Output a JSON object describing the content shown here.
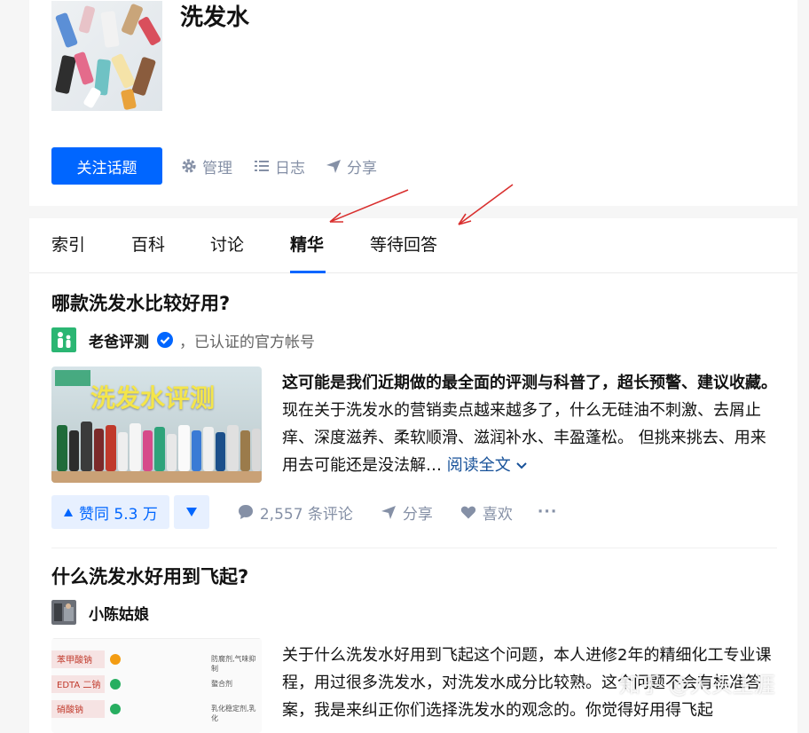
{
  "topic": {
    "title": "洗发水",
    "follow_label": "关注话题",
    "actions": [
      {
        "icon": "gear-icon",
        "label": "管理"
      },
      {
        "icon": "list-icon",
        "label": "日志"
      },
      {
        "icon": "share-icon",
        "label": "分享"
      }
    ]
  },
  "tabs": [
    "索引",
    "百科",
    "讨论",
    "精华",
    "等待回答"
  ],
  "active_tab": "精华",
  "answers": [
    {
      "question": "哪款洗发水比较好用?",
      "author": "老爸评测",
      "author_desc": "，已认证的官方帐号",
      "thumb_text": "洗发水评测",
      "excerpt_bold": "这可能是我们近期做的最全面的评测与科普了，超长预警、建议收藏。",
      "excerpt": " 现在关于洗发水的营销卖点越来越多了，什么无硅油不刺激、去屑止痒、深度滋养、柔软顺滑、滋润补水、丰盈蓬松。 但挑来挑去、用来用去可能还是没法解…",
      "read_more": "阅读全文",
      "vote_label": "赞同 5.3 万",
      "comments": "2,557 条评论",
      "share": "分享",
      "like": "喜欢",
      "more": "···"
    },
    {
      "question": "什么洗发水好用到飞起?",
      "author": "小陈姑娘",
      "excerpt": "关于什么洗发水好用到飞起这个问题，本人进修2年的精细化工专业课程，用过很多洗发水，对洗发水成分比较熟。这个问题不会有标准答案，我是来纠正你们选择洗发水的观念的。你觉得好用得飞起",
      "table_rows": [
        "苯甲酸钠",
        "EDTA 二钠",
        "硝酸钠"
      ],
      "table_right": [
        "防腐剂,气味抑制",
        "螯合剂",
        "乳化稳定剂,乳化"
      ]
    }
  ],
  "watermark": "知乎 @大头生涯",
  "colors": {
    "accent": "#0066ff",
    "muted": "#8590a6",
    "link": "#175199",
    "arrow": "#d9302f"
  }
}
